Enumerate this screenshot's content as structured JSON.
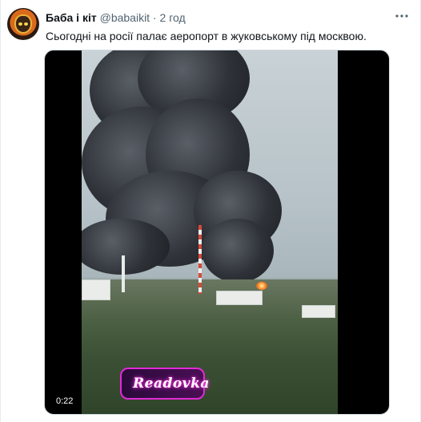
{
  "tweet": {
    "author": "Баба і кіт",
    "handle": "@babaikit",
    "separator": "·",
    "time": "2 год",
    "text": "Сьогодні на росії палає аеропорт в жуковському під москвою."
  },
  "video": {
    "duration": "0:22",
    "watermark": "Readovka"
  },
  "icons": {
    "avatar": "avatar-image",
    "more": "more-options-icon"
  },
  "colors": {
    "text_primary": "#0f1419",
    "text_secondary": "#536471",
    "watermark_glow": "#ff33e6"
  }
}
